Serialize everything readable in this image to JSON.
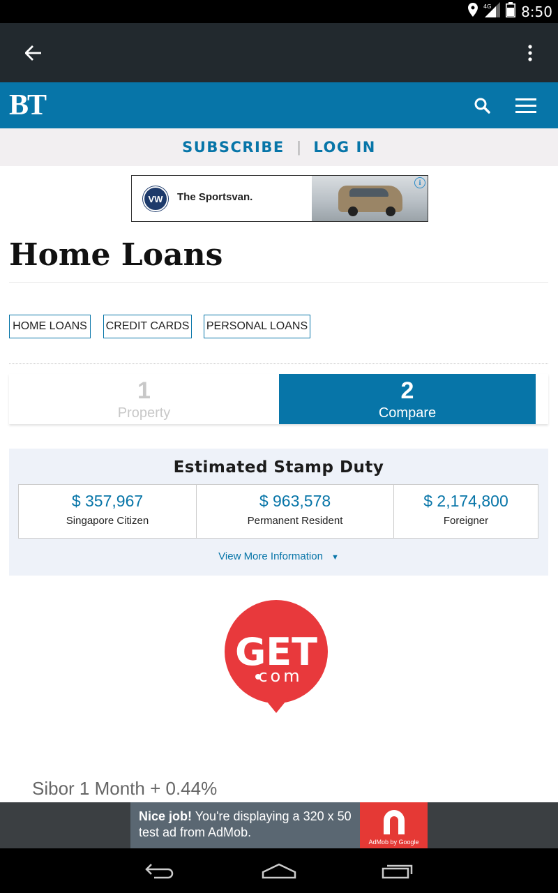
{
  "status_bar": {
    "time": "8:50",
    "network": "4G"
  },
  "brand": {
    "logo": "BT"
  },
  "account": {
    "subscribe": "SUBSCRIBE",
    "login": "LOG IN",
    "separator": "|"
  },
  "top_ad": {
    "text": "The Sportsvan.",
    "brand_mark": "VW",
    "info": "i"
  },
  "page": {
    "title": "Home Loans"
  },
  "categories": [
    {
      "label": "HOME LOANS"
    },
    {
      "label": "CREDIT CARDS"
    },
    {
      "label": "PERSONAL LOANS"
    }
  ],
  "steps": [
    {
      "number": "1",
      "label": "Property"
    },
    {
      "number": "2",
      "label": "Compare"
    }
  ],
  "stamp_duty": {
    "title": "Estimated Stamp Duty",
    "entries": [
      {
        "amount": "$ 357,967",
        "label": "Singapore Citizen"
      },
      {
        "amount": "$ 963,578",
        "label": "Permanent Resident"
      },
      {
        "amount": "$ 2,174,800",
        "label": "Foreigner"
      }
    ],
    "view_more": "View More Information"
  },
  "partner": {
    "logo_main": "GET",
    "logo_sub": "com"
  },
  "rate": {
    "text": "Sibor 1 Month + 0.44%"
  },
  "admob": {
    "bold": "Nice job!",
    "text": " You're displaying a 320 x 50 test ad from AdMob.",
    "logo_label": "AdMob by Google"
  },
  "colors": {
    "brand_blue": "#0775a8",
    "app_bar": "#22292e",
    "get_red": "#e8393c"
  }
}
